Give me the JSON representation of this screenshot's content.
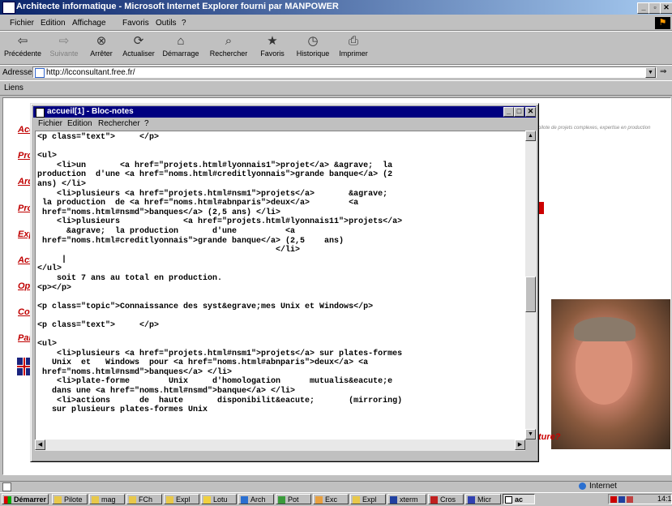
{
  "ie": {
    "title": "Architecte informatique - Microsoft Internet Explorer fourni par MANPOWER",
    "menu": [
      "Fichier",
      "Edition",
      "Affichage",
      "Favoris",
      "Outils",
      "?"
    ],
    "toolbar": [
      "Précédente",
      "Suivante",
      "Arrêter",
      "Actualiser",
      "Démarrage",
      "Rechercher",
      "Favoris",
      "Historique",
      "Imprimer"
    ],
    "address_label": "Adresse",
    "address_value": "http://lcconsultant.free.fr/",
    "links_label": "Liens",
    "status_zone": "Internet"
  },
  "page": {
    "side_links": [
      "Acc",
      "Pro",
      "Arc",
      "Pro",
      "Exp",
      "Act",
      "Opt",
      "Con",
      "Par"
    ],
    "tagline": "pilote de projets complexes, expertise en production",
    "footer_fragment": "ture?"
  },
  "notepad": {
    "title": "accueil[1] - Bloc-notes",
    "menu": [
      "Fichier",
      "Edition",
      "Rechercher",
      "?"
    ],
    "content": "<p class=\"text\">     </p>\n\n<ul>\n    <li>un       <a href=\"projets.html#lyonnais1\">projet</a> &agrave;  la\nproduction  d'une <a href=\"noms.html#creditlyonnais\">grande banque</a> (2\nans) </li>\n    <li>plusieurs <a href=\"projets.html#nsm1\">projets</a>       &agrave;\n la production  de <a href=\"noms.html#abnparis\">deux</a>        <a\n href=\"noms.html#nsmd\">banques</a> (2,5 ans) </li>\n    <li>plusieurs             <a href=\"projets.html#lyonnais11\">projets</a>\n      &agrave;  la production       d'une          <a\n href=\"noms.html#creditlyonnais\">grande banque</a> (2,5    ans)\n                                                 </li>\n     |\n</ul>\n    soit 7 ans au total en production.\n<p></p>\n\n<p class=\"topic\">Connaissance des syst&egrave;mes Unix et Windows</p>\n\n<p class=\"text\">     </p>\n\n<ul>\n    <li>plusieurs <a href=\"projets.html#nsm1\">projets</a> sur plates-formes\n   Unix  et   Windows  pour <a href=\"noms.html#abnparis\">deux</a> <a\n href=\"noms.html#nsmd\">banques</a> </li>\n    <li>plate-forme        Unix     d'homologation      mutualis&eacute;e\n   dans une <a href=\"noms.html#nsmd\">banque</a> </li>\n    <li>actions      de  haute       disponibilit&eacute;       (mirroring)\n   sur plusieurs plates-formes Unix"
  },
  "taskbar": {
    "start": "Démarrer",
    "tasks": [
      "Pilote",
      "mag",
      "FCh",
      "Expl",
      "Lotu",
      "Arch",
      "Pot",
      "Exc",
      "Expl",
      "xterm",
      "Cros",
      "Micr",
      "ac"
    ],
    "clock": "14:1"
  }
}
